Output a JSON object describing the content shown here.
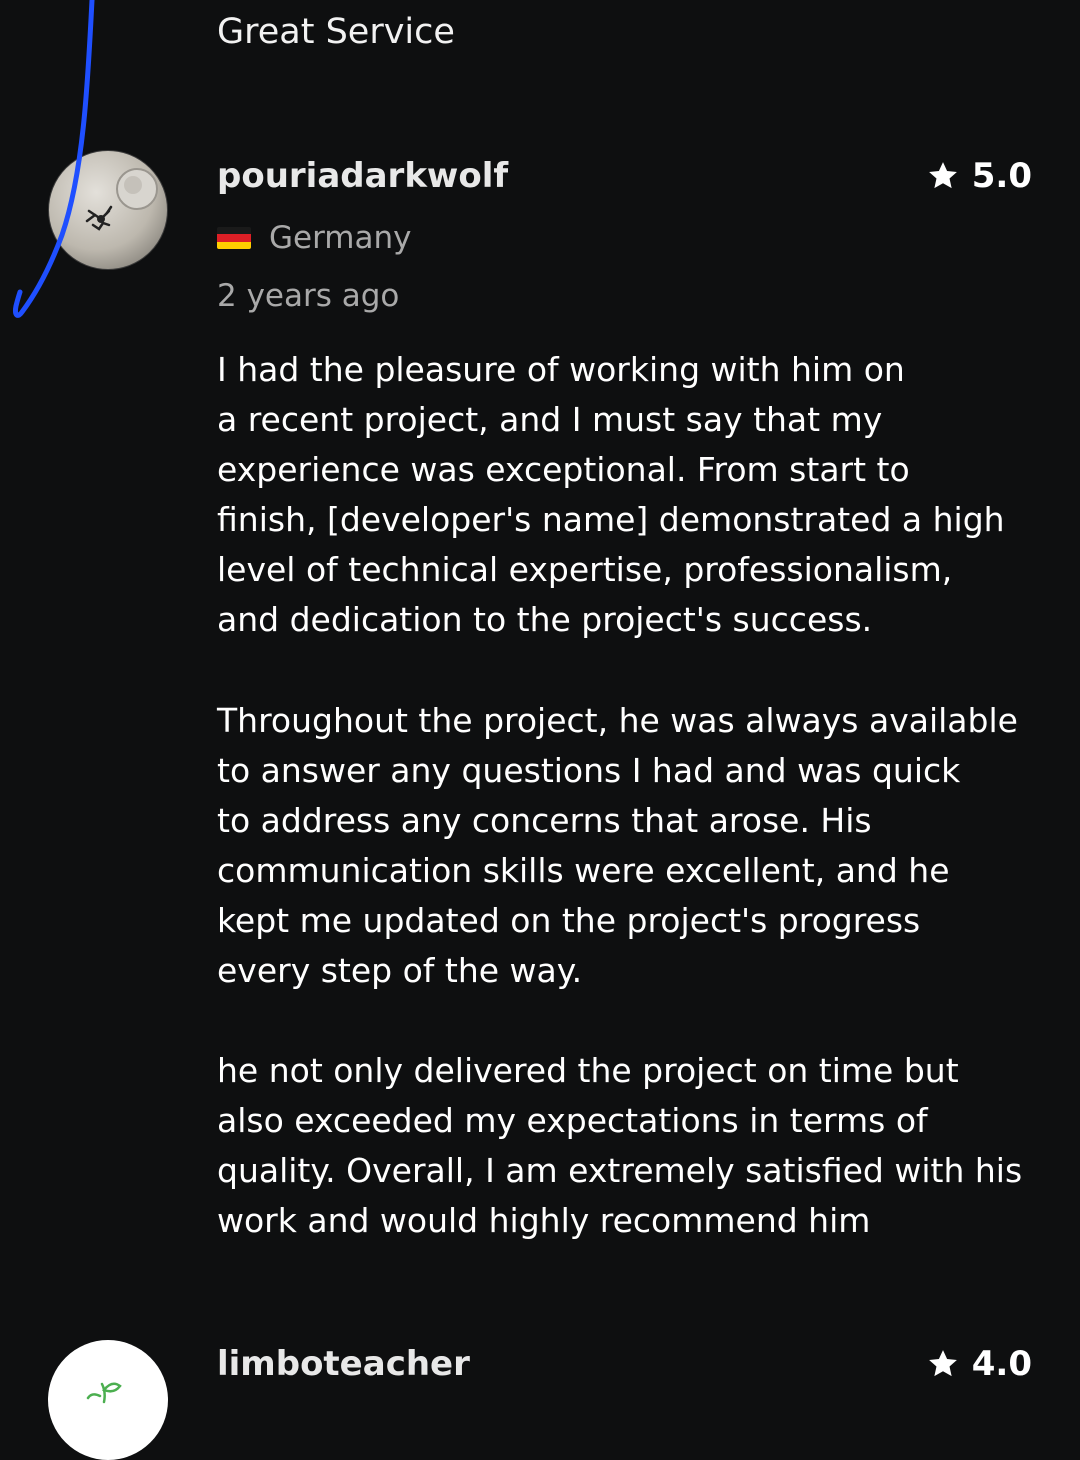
{
  "previous_review": {
    "title": "Great Service"
  },
  "reviews": [
    {
      "username": "pouriadarkwolf",
      "rating": "5.0",
      "country": "Germany",
      "time_ago": "2 years ago",
      "paragraphs": [
        "I had the pleasure of working with him on\na recent project, and I must say that my\nexperience was exceptional. From start to\nfinish, [developer's name] demonstrated a high\nlevel of technical expertise, professionalism,\nand dedication to the project's success.",
        "Throughout the project, he was always available\nto answer any questions I had and was quick\nto address any concerns that arose. His\ncommunication skills were excellent, and he\nkept me updated on the project's progress\nevery step of the way.",
        "he not only delivered the project on time but\nalso exceeded my expectations in terms of\nquality. Overall, I am extremely satisfied with his\nwork and would highly recommend him"
      ]
    },
    {
      "username": "limboteacher",
      "rating": "4.0"
    }
  ],
  "icons": {
    "rating": "star-icon",
    "country_flag": "germany-flag-icon"
  },
  "colors": {
    "background": "#0e0f10",
    "muted_text": "#a9a9a9",
    "pen_annotation": "#1f4fff"
  }
}
